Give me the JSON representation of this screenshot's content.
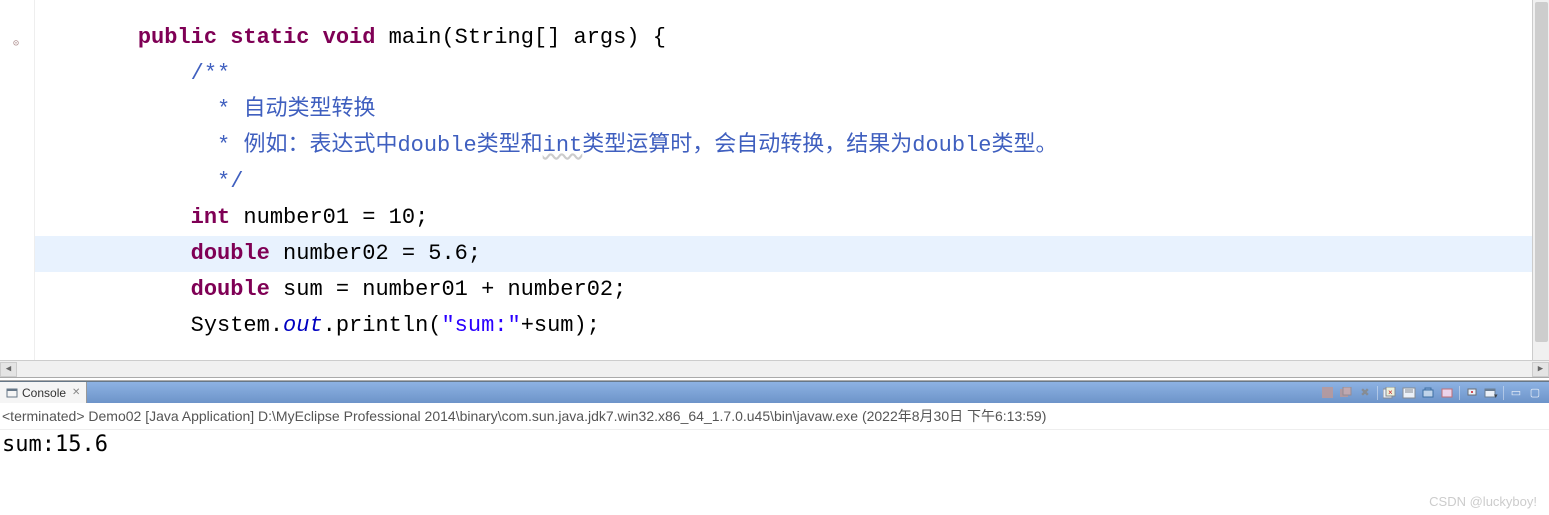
{
  "code": {
    "indent1": "    ",
    "indent2": "        ",
    "indent3": "         ",
    "line1": {
      "kw1": "public",
      "sp1": " ",
      "kw2": "static",
      "sp2": " ",
      "kw3": "void",
      "sp3": " ",
      "method": "main(String[] args) {"
    },
    "line2": {
      "text": "/**"
    },
    "line3": {
      "prefix": " * ",
      "text": "自动类型转换"
    },
    "line4": {
      "prefix": " * ",
      "t1": "例如：表达式中double类型和",
      "t2": "int",
      "t3": "类型运算时，会自动转换，结果为double类型。"
    },
    "line5": {
      "text": " */"
    },
    "line6": {
      "kw": "int",
      "rest": " number01 = 10;"
    },
    "line7": {
      "kw": "double",
      "rest": " number02 = 5.6;"
    },
    "line8": {
      "kw": "double",
      "rest": " sum = number01 + number02;"
    },
    "line9": {
      "p1": "System.",
      "field": "out",
      "p2": ".println(",
      "str": "\"sum:\"",
      "p3": "+sum);"
    }
  },
  "console": {
    "tabLabel": "Console",
    "status": "<terminated> Demo02 [Java Application] D:\\MyEclipse Professional 2014\\binary\\com.sun.java.jdk7.win32.x86_64_1.7.0.u45\\bin\\javaw.exe (2022年8月30日 下午6:13:59)",
    "output": "sum:15.6"
  },
  "watermark": "CSDN @luckyboy!"
}
